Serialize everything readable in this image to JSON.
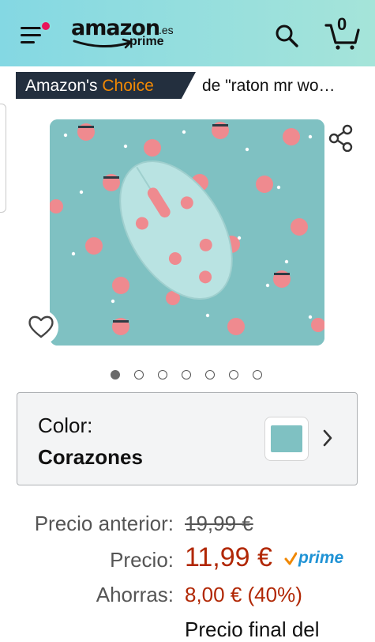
{
  "header": {
    "logo_text": "amazon",
    "logo_locale": ".es",
    "logo_prime": "prime",
    "cart_count": "0"
  },
  "icons": {
    "menu": "hamburger-menu-icon",
    "search": "search-icon",
    "cart": "cart-icon",
    "share": "share-icon",
    "wishlist": "heart-icon",
    "next": "chevron-right-icon"
  },
  "badge": {
    "prefix": "Amazon's",
    "highlight": "Choice",
    "query": "de \"raton mr wo…"
  },
  "carousel": {
    "total": 7,
    "active_index": 0
  },
  "variation": {
    "label": "Color:",
    "value": "Corazones"
  },
  "price": {
    "old_label": "Precio anterior:",
    "old_value": "19,99 €",
    "label": "Precio:",
    "value": "11,99 €",
    "prime": "prime",
    "savings_label": "Ahorras:",
    "savings_value": "8,00 € (40%)",
    "final_label": "Precio final del"
  },
  "colors": {
    "header_start": "#84d8e3",
    "header_end": "#a5e4d9",
    "badge_bg": "#232f3e",
    "badge_highlight": "#f08804",
    "price": "#b12704",
    "prime": "#2093d5",
    "notification_dot": "#e9155b"
  }
}
